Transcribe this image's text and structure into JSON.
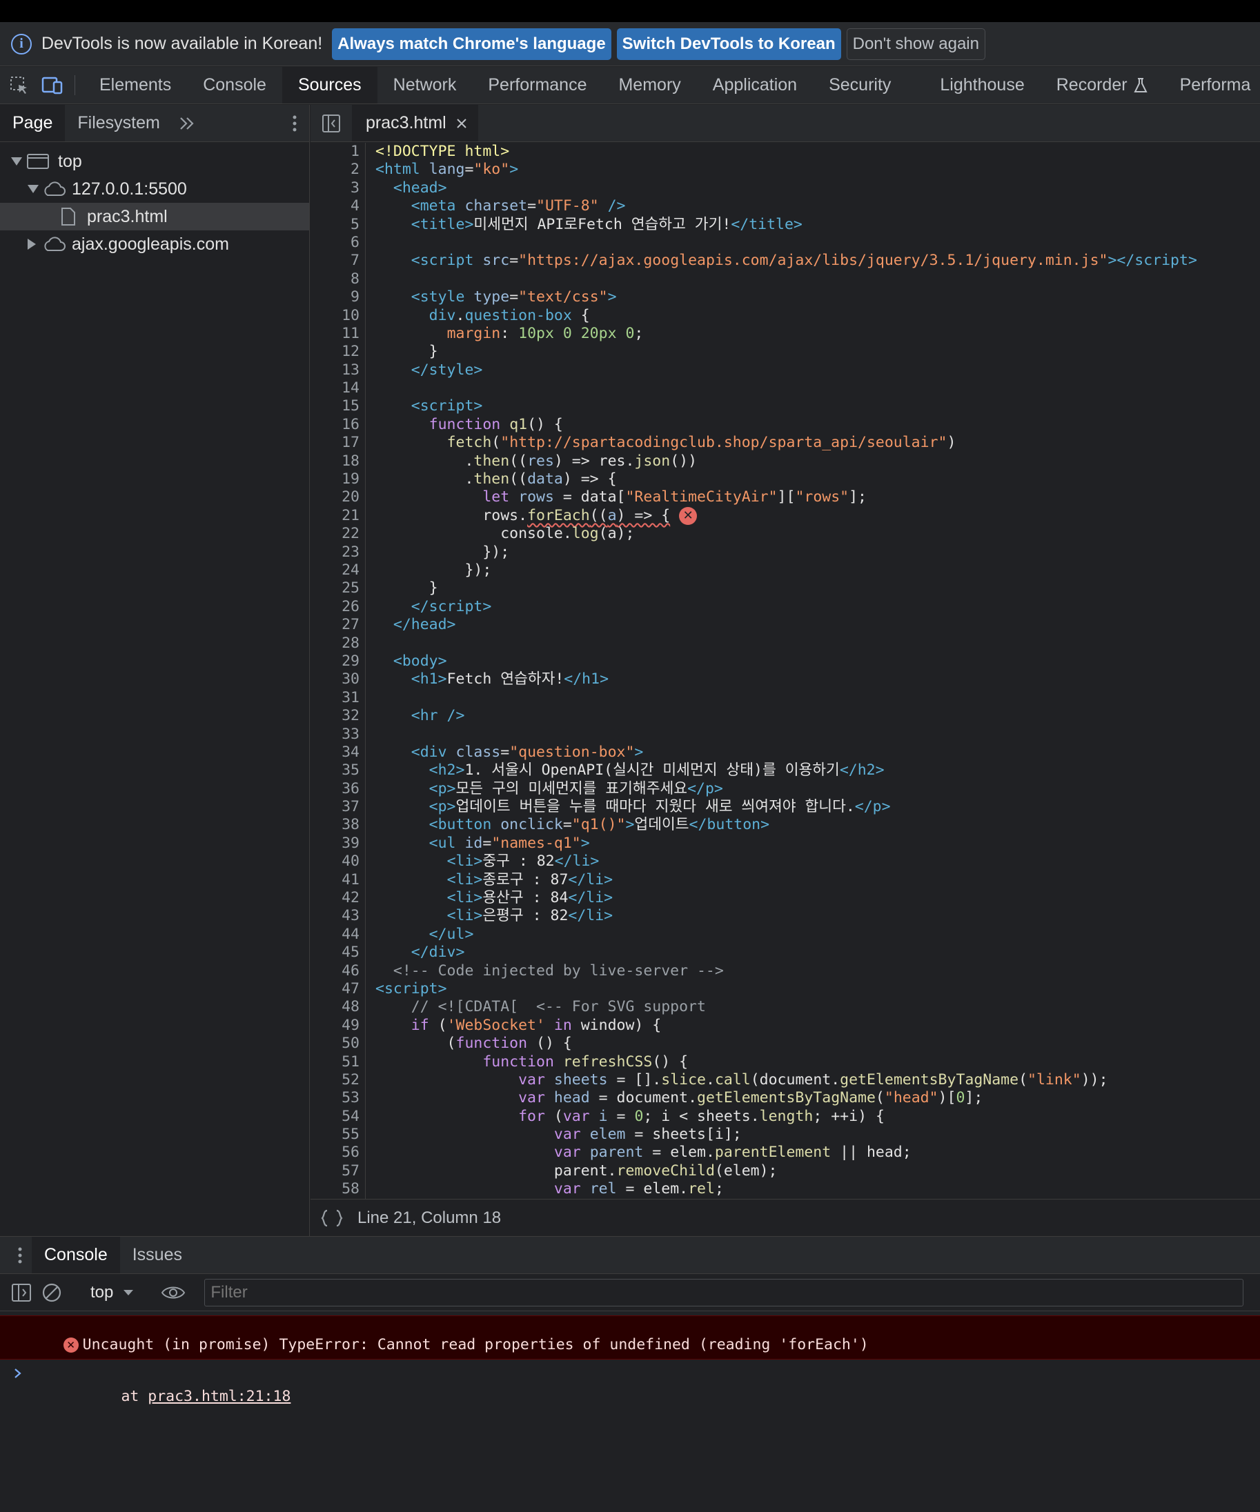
{
  "infobar": {
    "message": "DevTools is now available in Korean!",
    "btn_match": "Always match Chrome's language",
    "btn_switch": "Switch DevTools to Korean",
    "btn_dismiss": "Don't show again"
  },
  "main_tabs": [
    "Elements",
    "Console",
    "Sources",
    "Network",
    "Performance",
    "Memory",
    "Application",
    "Security",
    "Lighthouse",
    "Recorder",
    "Performa"
  ],
  "active_main_tab": "Sources",
  "navigator": {
    "tabs": [
      "Page",
      "Filesystem"
    ],
    "tree": {
      "top": "top",
      "origin": "127.0.0.1:5500",
      "file": "prac3.html",
      "external": "ajax.googleapis.com"
    }
  },
  "editor": {
    "file_tab": "prac3.html",
    "status": "Line 21, Column 18"
  },
  "drawer": {
    "tabs": [
      "Console",
      "Issues"
    ],
    "context": "top",
    "filter_placeholder": "Filter",
    "error_message": "Uncaught (in promise) TypeError: Cannot read properties of undefined (reading 'forEach')",
    "error_at": "    at ",
    "error_link": "prac3.html:21:18"
  },
  "colors": {
    "accent": "#7cacf8",
    "error": "#e46962",
    "button": "#2f6fb3"
  }
}
